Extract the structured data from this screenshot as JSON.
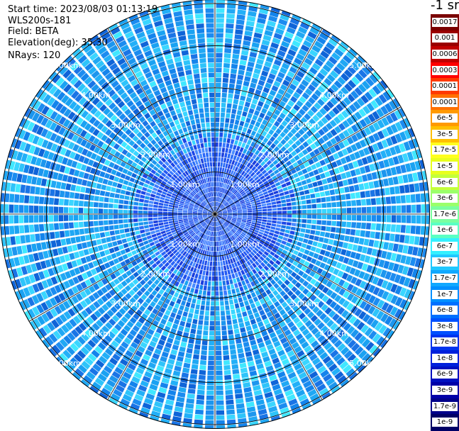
{
  "header": {
    "start_time": "Start time: 2023/08/03 01:13:19",
    "instrument": "WLS200s-181",
    "field": "Field: BETA",
    "elevation": "Elevation(deg): 35.30",
    "nrays": "NRays: 120"
  },
  "colorbar": {
    "unit": "-1 sr",
    "ticks": [
      "0.0017",
      "0.001",
      "0.0006",
      "0.0003",
      "0.00017",
      "0.0001",
      "6e-5",
      "3e-5",
      "1.7e-5",
      "1e-5",
      "6e-6",
      "3e-6",
      "1.7e-6",
      "1e-6",
      "6e-7",
      "3e-7",
      "1.7e-7",
      "1e-7",
      "6e-8",
      "3e-8",
      "1.7e-8",
      "1e-8",
      "6e-9",
      "3e-9",
      "1.7e-9",
      "1e-9"
    ],
    "colors": [
      "#7a0000",
      "#9a0000",
      "#c00000",
      "#ff0000",
      "#ff3a00",
      "#ff7000",
      "#ff9a00",
      "#ffc000",
      "#ffff1e",
      "#e8ff1e",
      "#c4ff3a",
      "#9aff6a",
      "#7affa0",
      "#5affc4",
      "#34f0ff",
      "#20c8ff",
      "#10a8ff",
      "#0090ff",
      "#0070ff",
      "#0050ff",
      "#0034ee",
      "#0020dc",
      "#0010c0",
      "#0000a8",
      "#00008a",
      "#000066"
    ]
  },
  "chart_data": {
    "type": "heatmap",
    "projection": "polar PPI (plan position indicator)",
    "field": "BETA",
    "nrays": 120,
    "elevation_deg": 35.3,
    "range_rings_km": [
      1.0,
      2.0,
      3.0,
      4.0,
      5.0
    ],
    "ring_labels": [
      "1.00km",
      "2.00km",
      "3.00km",
      "4.00km",
      "5.00km"
    ],
    "max_range_km": 5.1,
    "spokes_deg_step": 30,
    "color_scale": "log",
    "value_range": [
      "1e-9",
      "0.0017"
    ],
    "dominant_values": {
      "inner_1_to_2km": "about 1e-8 to 3e-8",
      "outer_2_to_5km": "about 3e-8 to 1.7e-7"
    },
    "grid": true
  }
}
